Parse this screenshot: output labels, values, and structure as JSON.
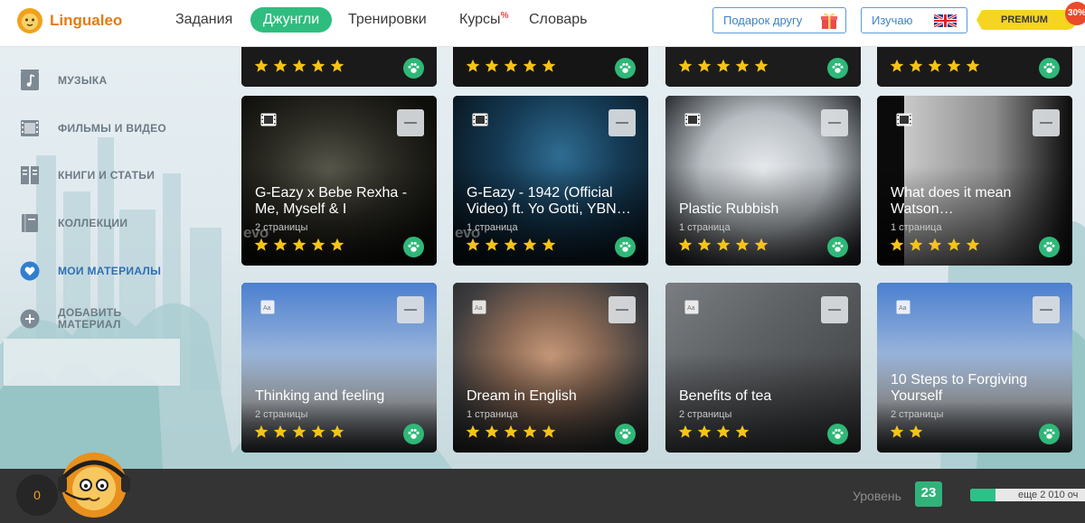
{
  "header": {
    "logo_text": "Lingualeo",
    "nav": [
      {
        "label": "Задания"
      },
      {
        "label": "Джунгли"
      },
      {
        "label": "Тренировки"
      },
      {
        "label": "Курсы",
        "badge": "%"
      },
      {
        "label": "Словарь"
      }
    ],
    "gift_button": "Подарок другу",
    "learning_button": "Изучаю",
    "premium_label": "PREMIUM",
    "premium_discount": "30%"
  },
  "sidebar": {
    "items": [
      {
        "label": "Музыка",
        "icon": "music-icon"
      },
      {
        "label": "Фильмы и видео",
        "icon": "film-icon"
      },
      {
        "label": "Книги и статьи",
        "icon": "book-icon"
      },
      {
        "label": "Коллекции",
        "icon": "collection-icon"
      },
      {
        "label": "Мои материалы",
        "icon": "heart-icon",
        "active": true
      },
      {
        "label": "Добавить материал",
        "icon": "plus-icon"
      }
    ]
  },
  "cards": [
    {
      "title": "G-Eazy x Bebe Rexha - Me, Myself & I",
      "pages": "2 страницы",
      "rating": 5,
      "type": "video"
    },
    {
      "title": "G-Eazy - 1942 (Official Video) ft. Yo Gotti, YBN…",
      "pages": "1 страница",
      "rating": 5,
      "type": "video"
    },
    {
      "title": "Plastic Rubbish",
      "pages": "1 страница",
      "rating": 5,
      "type": "video"
    },
    {
      "title": "What does it mean Watson…",
      "pages": "1 страница",
      "rating": 5,
      "type": "video"
    },
    {
      "title": "Thinking and feeling",
      "pages": "2 страницы",
      "rating": 5,
      "type": "text"
    },
    {
      "title": "Dream in English",
      "pages": "1 страница",
      "rating": 5,
      "type": "text"
    },
    {
      "title": "Benefits of tea",
      "pages": "2 страницы",
      "rating": 4,
      "type": "text"
    },
    {
      "title": "10 Steps to Forgiving Yourself",
      "pages": "2 страницы",
      "rating": 2,
      "type": "text"
    }
  ],
  "footer": {
    "coins": "0",
    "level_label": "Уровень",
    "level": "23",
    "progress_fraction": 0.2,
    "progress_text": "еще 2 010 оч"
  },
  "colors": {
    "accent_green": "#2fbd7f",
    "brand_orange": "#e47b14",
    "link_blue": "#3d84c6",
    "premium_yellow": "#f5d422",
    "star_yellow": "#f6c417"
  }
}
